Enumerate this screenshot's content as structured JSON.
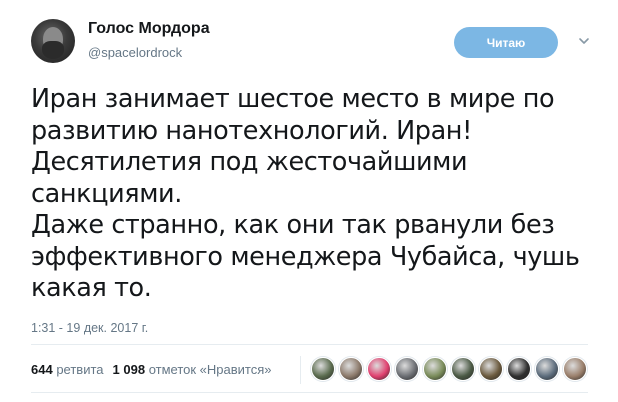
{
  "author": {
    "display_name": "Голос Мордора",
    "handle": "@spacelordrock"
  },
  "follow_button": {
    "label": "Читаю"
  },
  "tweet": {
    "lines": [
      "Иран занимает шестое место в мире по",
      "развитию нанотехнологий. Иран!",
      "Десятилетия под жесточайшими",
      "санкциями.",
      "Даже странно, как они так рванули без",
      "эффективного менеджера Чубайса, чушь",
      "какая то."
    ],
    "timestamp": "1:31 - 19 дек. 2017 г."
  },
  "stats": {
    "retweets_count": "644",
    "retweets_label": "ретвита",
    "likes_count": "1 098",
    "likes_label": "отметок «Нравится»"
  },
  "likers": [
    {
      "name": "liker-1",
      "color": "#5a6b4e"
    },
    {
      "name": "liker-2",
      "color": "#8c7a6b"
    },
    {
      "name": "liker-3",
      "color": "#e0406f"
    },
    {
      "name": "liker-4",
      "color": "#6b6e73"
    },
    {
      "name": "liker-5",
      "color": "#7a8c5a"
    },
    {
      "name": "liker-6",
      "color": "#4b5a45"
    },
    {
      "name": "liker-7",
      "color": "#6b5a3e"
    },
    {
      "name": "liker-8",
      "color": "#2f2f2f"
    },
    {
      "name": "liker-9",
      "color": "#5c6c7c"
    },
    {
      "name": "liker-10",
      "color": "#9a7f6b"
    }
  ],
  "colors": {
    "follow_button_bg": "#7cb7e4",
    "secondary_text": "#657786",
    "primary_text": "#14171a"
  }
}
